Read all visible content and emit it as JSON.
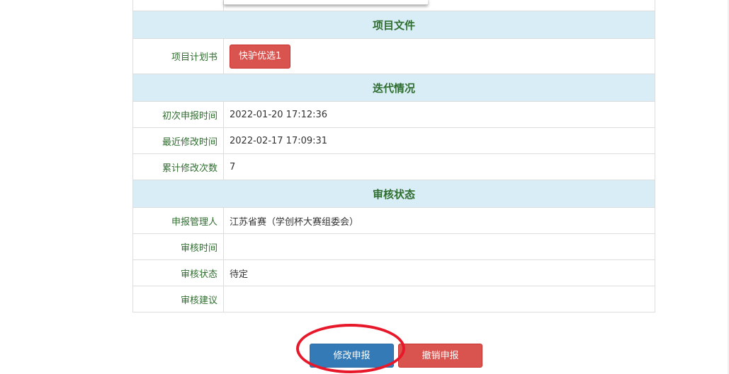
{
  "sections": {
    "files": "项目文件",
    "iterations": "迭代情况",
    "review": "审核状态"
  },
  "files": {
    "plan_label": "项目计划书",
    "plan_button": "快驴优选1"
  },
  "iterations": {
    "first_submit_label": "初次申报时间",
    "first_submit_value": "2022-01-20 17:12:36",
    "last_modified_label": "最近修改时间",
    "last_modified_value": "2022-02-17 17:09:31",
    "modify_count_label": "累计修改次数",
    "modify_count_value": "7"
  },
  "review": {
    "manager_label": "申报管理人",
    "manager_value": "江苏省赛（学创杯大赛组委会）",
    "review_time_label": "审核时间",
    "review_time_value": "",
    "status_label": "审核状态",
    "status_value": "待定",
    "advice_label": "审核建议",
    "advice_value": ""
  },
  "actions": {
    "edit_label": "修改申报",
    "cancel_label": "撤销申报"
  },
  "colors": {
    "section_bg": "#d9edf7",
    "label_text": "#2e6d2e",
    "primary_button": "#337ab7",
    "danger_button": "#d9534f",
    "annotation_circle": "#e8182b"
  }
}
